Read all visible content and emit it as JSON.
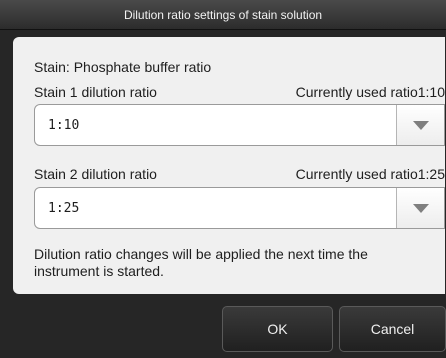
{
  "dialog": {
    "title": "Dilution ratio settings of stain solution"
  },
  "panel": {
    "heading": "Stain: Phosphate buffer ratio",
    "stain1": {
      "label": "Stain 1 dilution ratio",
      "current": "Currently used ratio1:10",
      "value": "1:10",
      "dropdown_icon": "triangle-down-icon"
    },
    "stain2": {
      "label": "Stain 2 dilution ratio",
      "current": "Currently used ratio1:25",
      "value": "1:25",
      "dropdown_icon": "triangle-down-icon"
    },
    "note": "Dilution ratio changes will be applied the next time the instrument is started."
  },
  "buttons": {
    "ok": "OK",
    "cancel": "Cancel"
  },
  "colors": {
    "panel_background": "#f0f0f0",
    "dialog_background": "#262626",
    "arrow": "#7f7f7f"
  }
}
